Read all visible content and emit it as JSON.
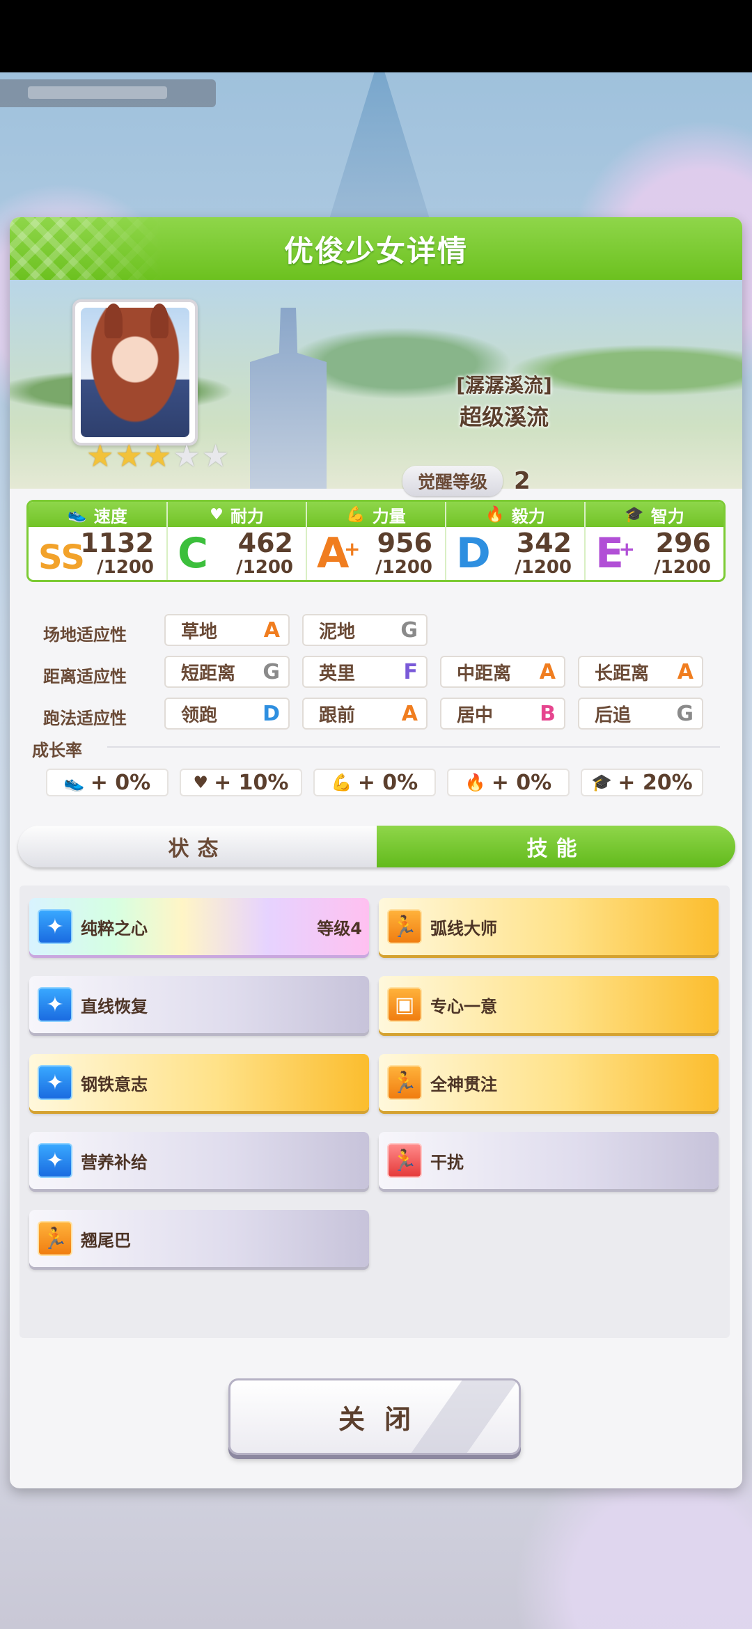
{
  "colors": {
    "accent_green": "#7ccb34",
    "rank_ss": "#f2a22a",
    "rank_c": "#3cbf3c",
    "rank_a": "#f07d1f",
    "rank_d": "#2e8fe0",
    "rank_e": "#b14fd6",
    "rank_b": "#e6458e",
    "rank_f": "#7a5ad8",
    "rank_g": "#8a8a8a"
  },
  "dialog": {
    "title": "优俊少女详情",
    "epithet_bracket": "[潺潺溪流]",
    "epithet_name": "超级溪流",
    "awaken_label": "觉醒等级",
    "awaken_value": "2",
    "stars_total": 5,
    "stars_filled": 3
  },
  "stats": [
    {
      "label": "速度",
      "icon": "shoe-icon",
      "glyph": "👟",
      "rank": "SS",
      "plus": "",
      "value": "1132",
      "max": "/1200",
      "color": "#f2a22a"
    },
    {
      "label": "耐力",
      "icon": "heart-icon",
      "glyph": "♥",
      "rank": "C",
      "plus": "",
      "value": "462",
      "max": "/1200",
      "color": "#3cbf3c"
    },
    {
      "label": "力量",
      "icon": "muscle-icon",
      "glyph": "💪",
      "rank": "A",
      "plus": "+",
      "value": "956",
      "max": "/1200",
      "color": "#f07d1f"
    },
    {
      "label": "毅力",
      "icon": "flame-icon",
      "glyph": "🔥",
      "rank": "D",
      "plus": "",
      "value": "342",
      "max": "/1200",
      "color": "#2e8fe0"
    },
    {
      "label": "智力",
      "icon": "graduation-cap-icon",
      "glyph": "🎓",
      "rank": "E",
      "plus": "+",
      "value": "296",
      "max": "/1200",
      "color": "#b14fd6"
    }
  ],
  "aptitude": {
    "track": {
      "label": "场地适应性",
      "items": [
        {
          "name": "草地",
          "grade": "A",
          "color": "#f07d1f"
        },
        {
          "name": "泥地",
          "grade": "G",
          "color": "#8a8a8a"
        }
      ]
    },
    "distance": {
      "label": "距离适应性",
      "items": [
        {
          "name": "短距离",
          "grade": "G",
          "color": "#8a8a8a"
        },
        {
          "name": "英里",
          "grade": "F",
          "color": "#7a5ad8"
        },
        {
          "name": "中距离",
          "grade": "A",
          "color": "#f07d1f"
        },
        {
          "name": "长距离",
          "grade": "A",
          "color": "#f07d1f"
        }
      ]
    },
    "style": {
      "label": "跑法适应性",
      "items": [
        {
          "name": "领跑",
          "grade": "D",
          "color": "#2e8fe0"
        },
        {
          "name": "跟前",
          "grade": "A",
          "color": "#f07d1f"
        },
        {
          "name": "居中",
          "grade": "B",
          "color": "#e6458e"
        },
        {
          "name": "后追",
          "grade": "G",
          "color": "#8a8a8a"
        }
      ]
    }
  },
  "growth": {
    "title": "成长率",
    "items": [
      {
        "icon": "shoe-icon",
        "glyph": "👟",
        "value": "+ 0%"
      },
      {
        "icon": "heart-icon",
        "glyph": "♥",
        "value": "+ 10%"
      },
      {
        "icon": "muscle-icon",
        "glyph": "💪",
        "value": "+ 0%"
      },
      {
        "icon": "flame-icon",
        "glyph": "🔥",
        "value": "+ 0%"
      },
      {
        "icon": "graduation-cap-icon",
        "glyph": "🎓",
        "value": "+ 20%"
      }
    ]
  },
  "tabs": [
    {
      "label": "状态",
      "active": false
    },
    {
      "label": "技能",
      "active": true
    }
  ],
  "skills": [
    {
      "name": "纯粹之心",
      "level": "等级4",
      "style": "rainbow",
      "icon": "sparkle-icon",
      "icon_color": "blue",
      "glyph": "✦"
    },
    {
      "name": "弧线大师",
      "level": "",
      "style": "gold",
      "icon": "runner-icon",
      "icon_color": "orange",
      "glyph": "🏃"
    },
    {
      "name": "直线恢复",
      "level": "",
      "style": "grey",
      "icon": "sparkle-icon",
      "icon_color": "blue",
      "glyph": "✦"
    },
    {
      "name": "专心一意",
      "level": "",
      "style": "gold",
      "icon": "focus-icon",
      "icon_color": "orange",
      "glyph": "▣"
    },
    {
      "name": "钢铁意志",
      "level": "",
      "style": "gold",
      "icon": "sparkle-icon",
      "icon_color": "blue",
      "glyph": "✦"
    },
    {
      "name": "全神贯注",
      "level": "",
      "style": "gold",
      "icon": "runner-icon",
      "icon_color": "orange",
      "glyph": "🏃"
    },
    {
      "name": "营养补给",
      "level": "",
      "style": "grey",
      "icon": "sparkle-icon",
      "icon_color": "blue",
      "glyph": "✦"
    },
    {
      "name": "干扰",
      "level": "",
      "style": "grey",
      "icon": "interfere-icon",
      "icon_color": "red",
      "glyph": "🏃"
    },
    {
      "name": "翘尾巴",
      "level": "",
      "style": "grey",
      "icon": "runner-icon",
      "icon_color": "orange",
      "glyph": "🏃"
    }
  ],
  "close_button": {
    "label": "关闭"
  }
}
